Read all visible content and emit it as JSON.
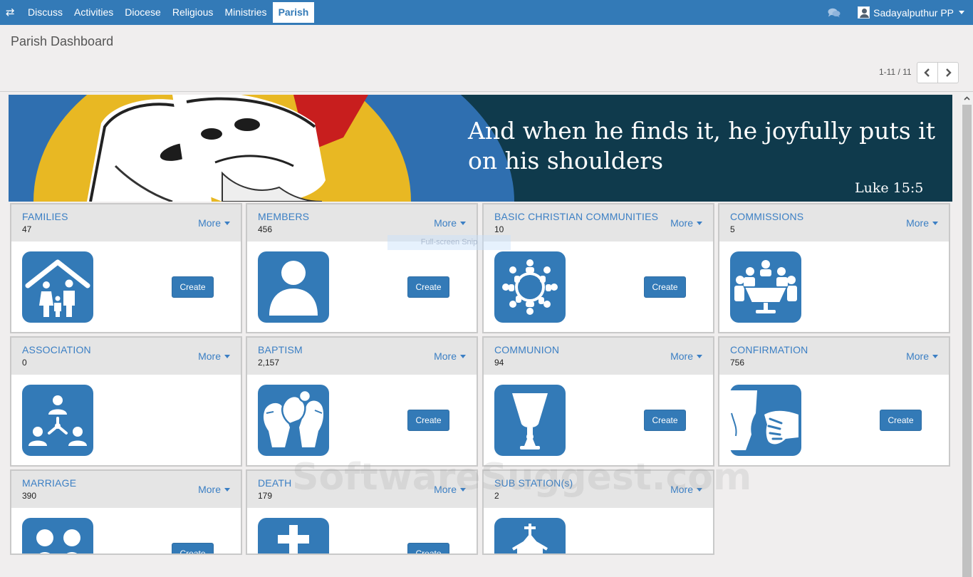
{
  "navbar": {
    "items": [
      {
        "label": "Discuss",
        "active": false
      },
      {
        "label": "Activities",
        "active": false
      },
      {
        "label": "Diocese",
        "active": false
      },
      {
        "label": "Religious",
        "active": false
      },
      {
        "label": "Ministries",
        "active": false
      },
      {
        "label": "Parish",
        "active": true
      }
    ],
    "user_name": "Sadayalputhur PP"
  },
  "header": {
    "title": "Parish Dashboard",
    "pager": "1-11 / 11"
  },
  "banner": {
    "quote": "And when he finds it, he joyfully puts it on his shoulders",
    "reference": "Luke 15:5"
  },
  "cards": [
    {
      "title": "FAMILIES",
      "count": "47",
      "more": "More",
      "create": "Create",
      "icon": "family-home-icon"
    },
    {
      "title": "MEMBERS",
      "count": "456",
      "more": "More",
      "create": "Create",
      "icon": "person-icon"
    },
    {
      "title": "BASIC CHRISTIAN COMMUNITIES",
      "count": "10",
      "more": "More",
      "create": "Create",
      "icon": "community-circle-icon"
    },
    {
      "title": "COMMISSIONS",
      "count": "5",
      "more": "More",
      "create": "",
      "icon": "meeting-table-icon"
    },
    {
      "title": "ASSOCIATION",
      "count": "0",
      "more": "More",
      "create": "",
      "icon": "association-network-icon"
    },
    {
      "title": "BAPTISM",
      "count": "2,157",
      "more": "More",
      "create": "Create",
      "icon": "baby-hands-icon"
    },
    {
      "title": "COMMUNION",
      "count": "94",
      "more": "More",
      "create": "Create",
      "icon": "chalice-icon"
    },
    {
      "title": "CONFIRMATION",
      "count": "756",
      "more": "More",
      "create": "Create",
      "icon": "anointing-hand-icon"
    },
    {
      "title": "MARRIAGE",
      "count": "390",
      "more": "More",
      "create": "Create",
      "icon": "couple-icon"
    },
    {
      "title": "DEATH",
      "count": "179",
      "more": "More",
      "create": "Create",
      "icon": "cross-icon"
    },
    {
      "title": "SUB STATION(s)",
      "count": "2",
      "more": "More",
      "create": "",
      "icon": "chapel-icon"
    }
  ],
  "overlays": {
    "snip_label": "Full-screen Snip",
    "watermark": "SoftwareSuggest.com"
  },
  "colors": {
    "primary": "#337ab7",
    "card_header": "#e5e5e5",
    "link": "#3b7fc4"
  }
}
